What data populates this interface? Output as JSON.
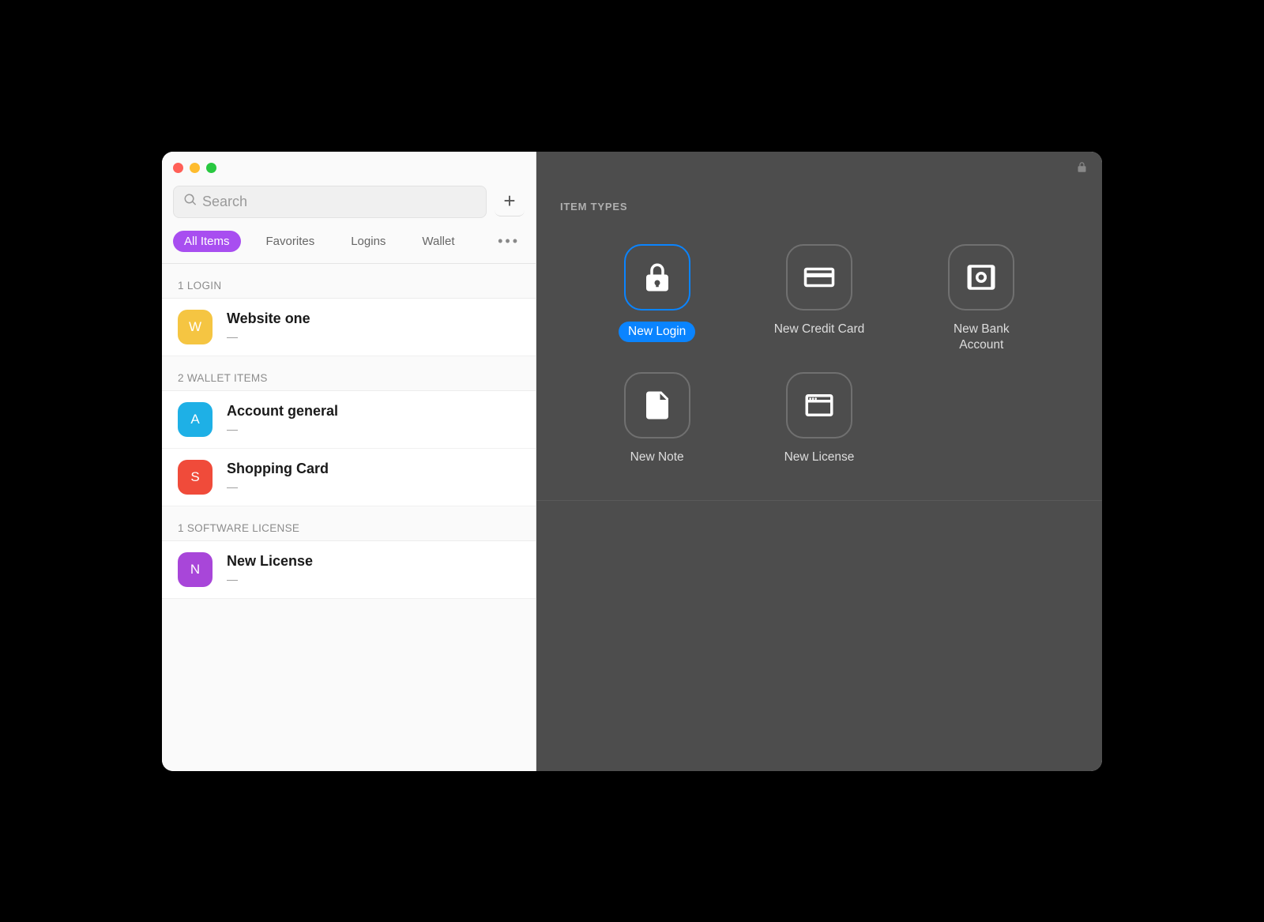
{
  "search": {
    "placeholder": "Search"
  },
  "filters": [
    {
      "label": "All Items",
      "active": true
    },
    {
      "label": "Favorites",
      "active": false
    },
    {
      "label": "Logins",
      "active": false
    },
    {
      "label": "Wallet",
      "active": false
    }
  ],
  "sections": [
    {
      "header": "1 LOGIN",
      "items": [
        {
          "initial": "W",
          "title": "Website one",
          "sub": "—",
          "color": "#f5c542"
        }
      ]
    },
    {
      "header": "2 WALLET ITEMS",
      "items": [
        {
          "initial": "A",
          "title": "Account general",
          "sub": "—",
          "color": "#1eb0e6"
        },
        {
          "initial": "S",
          "title": "Shopping Card",
          "sub": "—",
          "color": "#f04b3a"
        }
      ]
    },
    {
      "header": "1 SOFTWARE LICENSE",
      "items": [
        {
          "initial": "N",
          "title": "New License",
          "sub": "—",
          "color": "#a846d9"
        }
      ]
    }
  ],
  "detail": {
    "header": "ITEM TYPES",
    "types": [
      {
        "label": "New Login",
        "icon": "lock",
        "selected": true
      },
      {
        "label": "New Credit Card",
        "icon": "card",
        "selected": false
      },
      {
        "label": "New Bank Account",
        "icon": "vault",
        "selected": false
      },
      {
        "label": "New Note",
        "icon": "note",
        "selected": false
      },
      {
        "label": "New License",
        "icon": "window",
        "selected": false
      }
    ]
  },
  "colors": {
    "accent": "#a84ef0",
    "primary_blue": "#0a84ff"
  }
}
